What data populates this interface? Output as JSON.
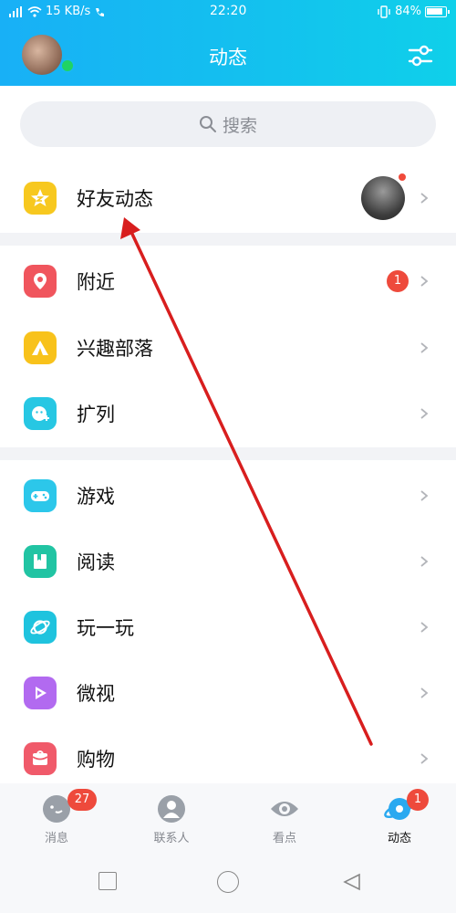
{
  "status_bar": {
    "network_speed": "15 KB/s",
    "time": "22:20",
    "battery": "84%"
  },
  "header": {
    "title": "动态",
    "online_color": "#20d364"
  },
  "search": {
    "placeholder": "搜索"
  },
  "sections": {
    "friends": {
      "label": "好友动态",
      "icon": "star-icon",
      "color": "#f7c81f"
    },
    "nearby": {
      "label": "附近",
      "icon": "location-pin-icon",
      "color": "#f0555d",
      "badge": "1"
    },
    "tribe": {
      "label": "兴趣部落",
      "icon": "tent-icon",
      "color": "#f8c21b"
    },
    "expand": {
      "label": "扩列",
      "icon": "smiley-plus-icon",
      "color": "#27c7e3"
    },
    "game": {
      "label": "游戏",
      "icon": "gamepad-icon",
      "color": "#2cc7ea"
    },
    "read": {
      "label": "阅读",
      "icon": "book-icon",
      "color": "#21c4a3"
    },
    "play": {
      "label": "玩一玩",
      "icon": "planet-icon",
      "color": "#1fc3de"
    },
    "weishi": {
      "label": "微视",
      "icon": "play-icon",
      "color": "#b26af0"
    },
    "shopping": {
      "label": "购物",
      "icon": "gift-icon",
      "color": "#f05a6a"
    }
  },
  "tabbar": {
    "messages": {
      "label": "消息",
      "badge": "27"
    },
    "contacts": {
      "label": "联系人"
    },
    "watch": {
      "label": "看点"
    },
    "dynamic": {
      "label": "动态",
      "badge": "1"
    }
  },
  "accent_color": "#18b8f2",
  "annotation_color": "#d81e1e"
}
